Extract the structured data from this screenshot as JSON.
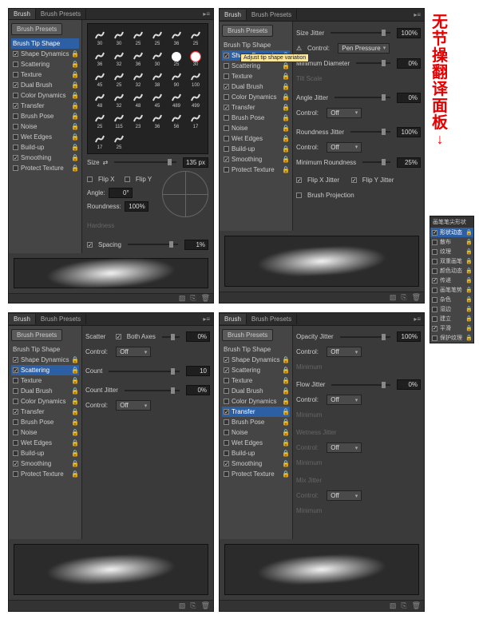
{
  "colors": {
    "accent": "#2d5fa5",
    "annot": "#e80000"
  },
  "tabs": {
    "brush": "Brush",
    "presets": "Brush Presets"
  },
  "buttons": {
    "brush_presets": "Brush Presets"
  },
  "side_items": [
    {
      "label": "Brush Tip Shape",
      "locked": false
    },
    {
      "label": "Shape Dynamics",
      "locked": true
    },
    {
      "label": "Scattering",
      "locked": true
    },
    {
      "label": "Texture",
      "locked": true
    },
    {
      "label": "Dual Brush",
      "locked": true
    },
    {
      "label": "Color Dynamics",
      "locked": true
    },
    {
      "label": "Transfer",
      "locked": true
    },
    {
      "label": "Brush Pose",
      "locked": true
    },
    {
      "label": "Noise",
      "locked": true
    },
    {
      "label": "Wet Edges",
      "locked": true
    },
    {
      "label": "Build-up",
      "locked": true
    },
    {
      "label": "Smoothing",
      "locked": true
    },
    {
      "label": "Protect Texture",
      "locked": true
    }
  ],
  "panel1": {
    "checked": [
      1,
      4,
      6,
      11
    ],
    "selected": 0,
    "thumbs": [
      "30",
      "30",
      "25",
      "25",
      "36",
      "25",
      "36",
      "32",
      "36",
      "30",
      "25",
      "30",
      "45",
      "25",
      "32",
      "38",
      "90",
      "100",
      "48",
      "32",
      "48",
      "45",
      "489",
      "499",
      "25",
      "115",
      "23",
      "36",
      "56",
      "17",
      "17",
      "25"
    ],
    "thumb_dot": [
      10,
      11
    ],
    "thumb_sel": 11,
    "size": {
      "label": "Size",
      "link": "⇄",
      "value": "135 px"
    },
    "flip_x": "Flip X",
    "flip_y": "Flip Y",
    "angle": {
      "label": "Angle:",
      "value": "0°"
    },
    "roundness": {
      "label": "Roundness:",
      "value": "100%"
    },
    "hardness": {
      "label": "Hardness"
    },
    "spacing": {
      "label": "Spacing",
      "value": "1%",
      "on": true
    }
  },
  "panel2": {
    "checked": [
      1,
      4,
      6,
      11
    ],
    "selected": 1,
    "size_jitter": {
      "label": "Size Jitter",
      "value": "100%"
    },
    "control": {
      "label": "Control:",
      "value": "Pen Pressure",
      "icon": "⚠"
    },
    "min_diam": {
      "label": "Minimum Diameter",
      "value": "0%"
    },
    "tilt": {
      "label": "Tilt Scale"
    },
    "angle_jitter": {
      "label": "Angle Jitter",
      "value": "0%"
    },
    "angle_control": {
      "label": "Control:",
      "value": "Off"
    },
    "round_jitter": {
      "label": "Roundness Jitter",
      "value": "100%"
    },
    "round_control": {
      "label": "Control:",
      "value": "Off"
    },
    "min_round": {
      "label": "Minimum Roundness",
      "value": "25%"
    },
    "flip_xj": "Flip X Jitter",
    "flip_yj": "Flip Y Jitter",
    "brush_proj": "Brush Projection",
    "tooltip": "Adjust tip shape variation"
  },
  "panel3": {
    "checked": [
      1,
      2,
      6,
      11
    ],
    "selected": 2,
    "scatter": {
      "label": "Scatter",
      "both": "Both Axes",
      "both_on": true,
      "value": "0%"
    },
    "control1": {
      "label": "Control:",
      "value": "Off"
    },
    "count": {
      "label": "Count",
      "value": "10"
    },
    "count_jitter": {
      "label": "Count Jitter",
      "value": "0%"
    },
    "control2": {
      "label": "Control:",
      "value": "Off"
    }
  },
  "panel4": {
    "checked": [
      1,
      2,
      6,
      11
    ],
    "selected": 6,
    "opacity": {
      "label": "Opacity Jitter",
      "value": "100%"
    },
    "control1": {
      "label": "Control:",
      "value": "Off"
    },
    "minimum": "Minimum",
    "flow": {
      "label": "Flow Jitter",
      "value": "0%"
    },
    "control2": {
      "label": "Control:",
      "value": "Off"
    },
    "wetness": "Wetness Jitter",
    "control3": {
      "label": "Control:",
      "value": "Off"
    },
    "mix": "Mix Jitter",
    "control4": {
      "label": "Control:",
      "value": "Off"
    }
  },
  "annot": {
    "text": "无节操翻译面板"
  },
  "mini": {
    "title": "画笔笔尖形状",
    "items": [
      "形状动态",
      "散布",
      "纹理",
      "双重画笔",
      "颜色动态",
      "传递",
      "画笔笔势",
      "杂色",
      "湿边",
      "建立",
      "平滑",
      "保护纹理"
    ],
    "selected": 0,
    "checked": [
      0,
      5,
      10
    ]
  }
}
